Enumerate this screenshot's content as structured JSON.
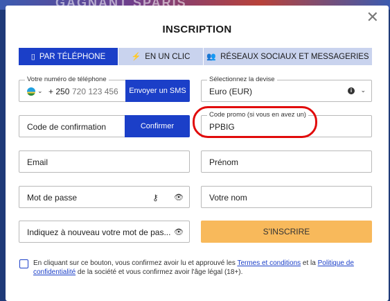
{
  "background": {
    "banner_text": "GAGNANT SPARIS"
  },
  "modal": {
    "title": "INSCRIPTION",
    "close_glyph": "✕"
  },
  "tabs": [
    {
      "label": "PAR TÉLÉPHONE",
      "icon": "mobile-phone-icon",
      "active": true
    },
    {
      "label": "EN UN CLIC",
      "icon": "lightning-icon",
      "active": false
    },
    {
      "label": "RÉSEAUX SOCIAUX ET MESSAGERIES",
      "icon": "users-icon",
      "active": false
    }
  ],
  "phone": {
    "label": "Votre numéro de téléphone",
    "prefix": "+ 250",
    "placeholder": "720 123 456",
    "send_sms_label": "Envoyer un SMS"
  },
  "currency": {
    "label": "Sélectionnez la devise",
    "value": "Euro (EUR)"
  },
  "confirmation": {
    "placeholder": "Code de confirmation",
    "confirm_label": "Confirmer"
  },
  "promo": {
    "label": "Code promo (si vous en avez un)",
    "value": "PPBIG"
  },
  "email": {
    "placeholder": "Email"
  },
  "first_name": {
    "placeholder": "Prénom"
  },
  "password": {
    "placeholder": "Mot de passe"
  },
  "last_name": {
    "placeholder": "Votre nom"
  },
  "password_confirm": {
    "placeholder": "Indiquez à nouveau votre mot de pas..."
  },
  "submit_label": "S'INSCRIRE",
  "consent": {
    "text_before": "En cliquant sur ce bouton, vous confirmez avoir lu et approuvé les ",
    "terms_link": "Termes et conditions",
    "text_middle": " et la ",
    "privacy_link": "Politique de confidentialité",
    "text_after": " de la société et vous confirmez avoir l'âge légal (18+)."
  },
  "colors": {
    "primary_blue": "#1b3fc8",
    "tab_inactive": "#c9d3ee",
    "submit_orange": "#f8b95b",
    "highlight_red": "#e10b0b"
  }
}
